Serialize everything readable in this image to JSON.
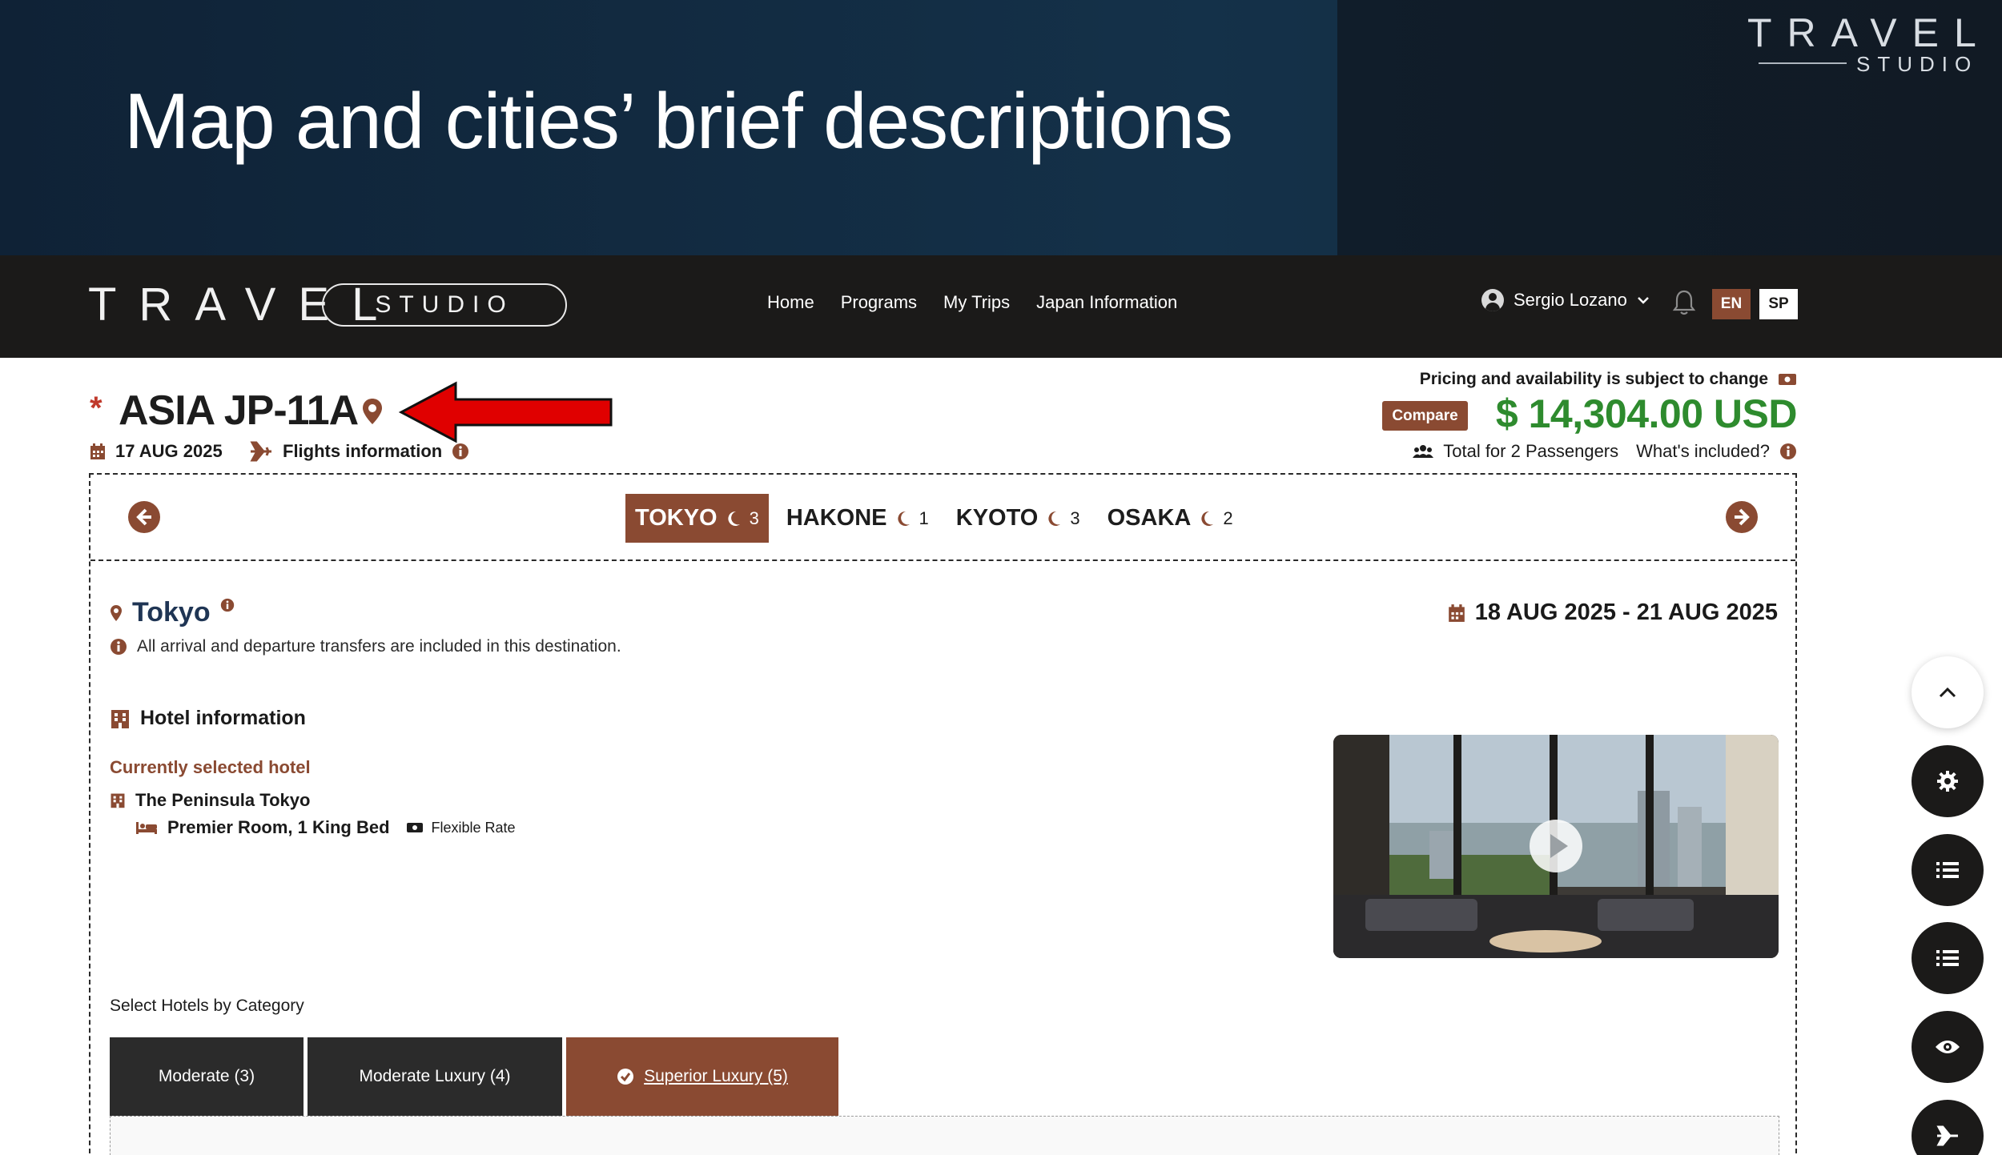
{
  "slide": {
    "title": "Map and cities’ brief descriptions",
    "brand_word": "TRAVEL",
    "brand_sub": "STUDIO"
  },
  "navbar": {
    "logo_word": "TRAVEL",
    "logo_badge": "STUDIO",
    "links": [
      "Home",
      "Programs",
      "My Trips",
      "Japan Information"
    ],
    "user_name": "Sergio Lozano",
    "lang_active": "EN",
    "lang_other": "SP"
  },
  "trip": {
    "asterisk": "*",
    "code": "ASIA JP-11A",
    "date": "17 AUG 2025",
    "flights_label": "Flights information",
    "pricing_note": "Pricing and availability is subject to change",
    "compare_label": "Compare",
    "price": "$ 14,304.00 USD",
    "passengers": "Total for 2 Passengers",
    "whats_included": "What's included?"
  },
  "destinations": [
    {
      "name": "TOKYO",
      "nights": "3",
      "active": true
    },
    {
      "name": "HAKONE",
      "nights": "1",
      "active": false
    },
    {
      "name": "KYOTO",
      "nights": "3",
      "active": false
    },
    {
      "name": "OSAKA",
      "nights": "2",
      "active": false
    }
  ],
  "destination_detail": {
    "city": "Tokyo",
    "transfer_note": "All arrival and departure transfers are included in this destination.",
    "date_range": "18 AUG 2025 - 21 AUG 2025",
    "hotel_info_heading": "Hotel information",
    "current_hotel_label": "Currently selected hotel",
    "hotel_name": "The Peninsula Tokyo",
    "room": "Premier Room, 1 King Bed",
    "rate": "Flexible Rate",
    "select_category_label": "Select Hotels by Category",
    "categories": [
      "Moderate (3)",
      "Moderate Luxury (4)",
      "Superior Luxury (5)"
    ]
  },
  "colors": {
    "accent": "#8a4a32",
    "price_green": "#2e8b2e",
    "navbar_bg": "#1b1a19",
    "banner_bg": "#143149",
    "city_blue": "#1f3554"
  },
  "icons": [
    "pin-icon",
    "red-arrow-annotation",
    "calendar-icon",
    "plane-icon",
    "info-icon",
    "money-icon",
    "users-icon",
    "moon-icon",
    "hotel-icon",
    "bed-icon",
    "ticket-icon",
    "check-circle-icon",
    "chevron-up-icon",
    "gear-icon",
    "list-icon",
    "eye-icon",
    "bell-icon",
    "user-icon"
  ]
}
